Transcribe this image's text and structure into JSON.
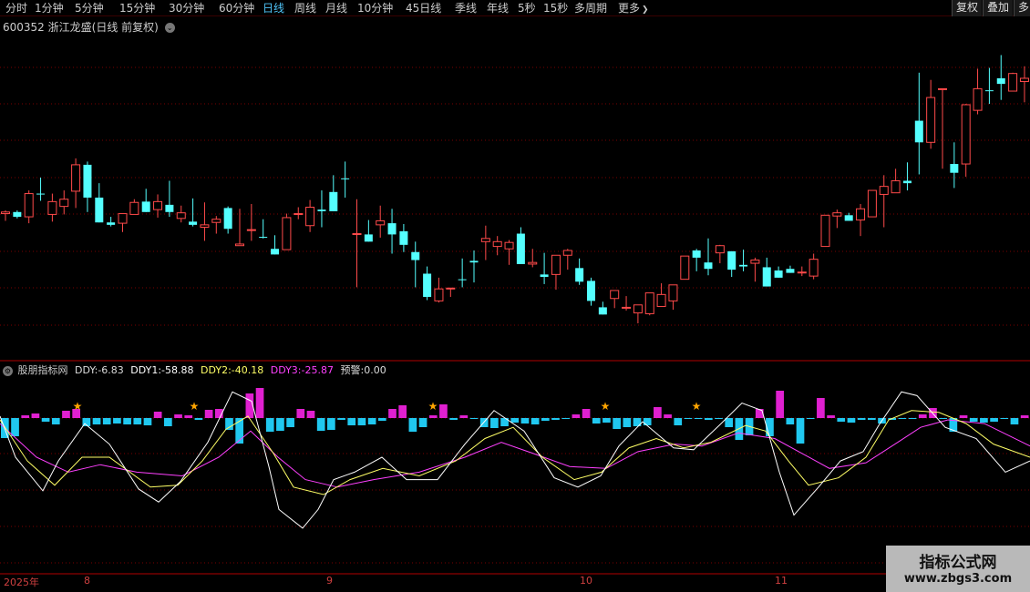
{
  "toolbar": {
    "periods": [
      {
        "label": "分时",
        "active": false
      },
      {
        "label": "1分钟",
        "active": false
      },
      {
        "label": "5分钟",
        "active": false
      },
      {
        "label": "15分钟",
        "active": false
      },
      {
        "label": "30分钟",
        "active": false
      },
      {
        "label": "60分钟",
        "active": false
      },
      {
        "label": "日线",
        "active": true
      },
      {
        "label": "周线",
        "active": false
      },
      {
        "label": "月线",
        "active": false
      },
      {
        "label": "10分钟",
        "active": false
      },
      {
        "label": "45日线",
        "active": false
      },
      {
        "label": "季线",
        "active": false
      },
      {
        "label": "年线",
        "active": false
      },
      {
        "label": "5秒",
        "active": false
      },
      {
        "label": "15秒",
        "active": false
      },
      {
        "label": "多周期",
        "active": false
      },
      {
        "label": "更多",
        "active": false
      }
    ],
    "more_arrow": "❯",
    "right_buttons": [
      "复权",
      "叠加",
      "多"
    ]
  },
  "kline": {
    "code": "600352",
    "name": "浙江龙盛",
    "mode": "(日线 前复权)",
    "dropdown": "⌄"
  },
  "indicator": {
    "name": "股朋指标网",
    "ddy_label": "DDY:",
    "ddy": "-6.83",
    "ddy1_label": "DDY1:",
    "ddy1": "-58.88",
    "ddy2_label": "DDY2:",
    "ddy2": "-40.18",
    "ddy3_label": "DDY3:",
    "ddy3": "-25.87",
    "alert_label": "预警:",
    "alert": "0.00"
  },
  "dates": {
    "year": "2025年",
    "m8": "8",
    "m9": "9",
    "m10": "10",
    "m11": "11"
  },
  "watermark": {
    "title": "指标公式网",
    "url": "www.zbgs3.com"
  },
  "colors": {
    "up": "#ff4a4a",
    "down": "#54ffff",
    "grid": "#7a0000",
    "ddy1": "#ffffff",
    "ddy2": "#ffff66",
    "ddy3": "#ff40ff",
    "bar_pos": "#e020d0",
    "bar_neg": "#20c8f0",
    "star": "#ffa500"
  },
  "kline_data": [
    [
      7.17,
      7.21,
      7.08,
      7.19
    ],
    [
      7.19,
      7.21,
      7.11,
      7.13
    ],
    [
      7.13,
      7.46,
      7.05,
      7.42
    ],
    [
      7.42,
      7.62,
      7.33,
      7.41
    ],
    [
      7.16,
      7.42,
      7.07,
      7.32
    ],
    [
      7.26,
      7.46,
      7.16,
      7.35
    ],
    [
      7.45,
      7.86,
      7.24,
      7.78
    ],
    [
      7.78,
      7.82,
      7.19,
      7.37
    ],
    [
      7.37,
      7.55,
      7.06,
      7.06
    ],
    [
      7.06,
      7.13,
      7.01,
      7.03
    ],
    [
      7.05,
      7.16,
      6.94,
      7.17
    ],
    [
      7.16,
      7.35,
      7.17,
      7.31
    ],
    [
      7.32,
      7.48,
      7.23,
      7.19
    ],
    [
      7.22,
      7.41,
      7.12,
      7.32
    ],
    [
      7.28,
      7.58,
      7.13,
      7.19
    ],
    [
      7.11,
      7.27,
      7.06,
      7.18
    ],
    [
      7.07,
      7.36,
      7.01,
      7.03
    ],
    [
      7.0,
      7.31,
      6.83,
      7.03
    ],
    [
      7.06,
      7.14,
      6.92,
      7.1
    ],
    [
      7.24,
      7.26,
      6.92,
      6.98
    ],
    [
      6.77,
      7.23,
      6.79,
      6.79
    ],
    [
      6.97,
      7.29,
      6.83,
      6.97
    ],
    [
      6.88,
      7.1,
      6.86,
      6.87
    ],
    [
      6.73,
      6.9,
      6.73,
      6.66
    ],
    [
      6.72,
      7.17,
      6.72,
      7.12
    ],
    [
      7.16,
      7.25,
      7.1,
      7.17
    ],
    [
      7.02,
      7.34,
      6.94,
      7.25
    ],
    [
      7.22,
      7.46,
      7.0,
      7.2
    ],
    [
      7.44,
      7.65,
      7.32,
      7.2
    ],
    [
      7.61,
      7.82,
      7.37,
      7.6
    ],
    [
      6.92,
      7.35,
      6.25,
      6.92
    ],
    [
      6.91,
      7.09,
      6.82,
      6.82
    ],
    [
      7.03,
      7.27,
      6.87,
      7.08
    ],
    [
      7.05,
      7.23,
      6.67,
      6.91
    ],
    [
      6.95,
      7.04,
      6.69,
      6.78
    ],
    [
      6.69,
      6.82,
      6.25,
      6.59
    ],
    [
      6.42,
      6.51,
      6.09,
      6.13
    ],
    [
      6.08,
      6.37,
      6.06,
      6.23
    ],
    [
      6.23,
      6.17,
      6.13,
      6.24
    ],
    [
      6.35,
      6.61,
      6.25,
      6.34
    ],
    [
      6.58,
      6.71,
      6.31,
      6.56
    ],
    [
      6.82,
      7.02,
      6.59,
      6.86
    ],
    [
      6.76,
      6.89,
      6.65,
      6.82
    ],
    [
      6.73,
      6.84,
      6.53,
      6.81
    ],
    [
      6.92,
      7.0,
      6.65,
      6.54
    ],
    [
      6.54,
      6.73,
      6.5,
      6.56
    ],
    [
      6.41,
      6.68,
      6.29,
      6.38
    ],
    [
      6.41,
      6.56,
      6.22,
      6.65
    ],
    [
      6.65,
      6.73,
      6.47,
      6.71
    ],
    [
      6.49,
      6.61,
      6.28,
      6.32
    ],
    [
      6.33,
      6.37,
      6.02,
      6.08
    ],
    [
      6.0,
      6.07,
      5.91,
      5.91
    ],
    [
      6.11,
      6.12,
      5.99,
      6.21
    ],
    [
      6.0,
      6.14,
      5.96,
      6.0
    ],
    [
      5.93,
      5.99,
      5.8,
      6.03
    ],
    [
      5.92,
      6.16,
      5.9,
      6.18
    ],
    [
      6.01,
      6.3,
      6.08,
      6.16
    ],
    [
      6.08,
      6.23,
      5.97,
      6.28
    ],
    [
      6.35,
      6.58,
      6.49,
      6.64
    ],
    [
      6.71,
      6.73,
      6.45,
      6.62
    ],
    [
      6.56,
      6.86,
      6.4,
      6.48
    ],
    [
      6.68,
      6.78,
      6.55,
      6.77
    ],
    [
      6.7,
      6.62,
      6.38,
      6.47
    ],
    [
      6.53,
      6.72,
      6.45,
      6.51
    ],
    [
      6.55,
      6.62,
      6.32,
      6.59
    ],
    [
      6.5,
      6.62,
      6.29,
      6.26
    ],
    [
      6.46,
      6.51,
      6.4,
      6.37
    ],
    [
      6.48,
      6.52,
      6.45,
      6.43
    ],
    [
      6.44,
      6.51,
      6.39,
      6.44
    ],
    [
      6.39,
      6.67,
      6.35,
      6.6
    ],
    [
      6.76,
      7.12,
      6.76,
      7.15
    ],
    [
      7.14,
      7.22,
      6.99,
      7.18
    ],
    [
      7.15,
      7.18,
      7.15,
      7.08
    ],
    [
      7.09,
      7.29,
      6.89,
      7.23
    ],
    [
      7.13,
      7.39,
      7.13,
      7.46
    ],
    [
      7.41,
      7.65,
      7.0,
      7.51
    ],
    [
      7.43,
      7.73,
      7.43,
      7.58
    ],
    [
      7.58,
      7.81,
      7.46,
      7.55
    ],
    [
      8.33,
      8.93,
      7.66,
      8.06
    ],
    [
      8.06,
      8.84,
      7.98,
      8.62
    ],
    [
      8.73,
      8.73,
      7.73,
      8.73
    ],
    [
      7.79,
      8.06,
      7.49,
      7.68
    ],
    [
      7.79,
      8.54,
      7.63,
      8.53
    ],
    [
      8.46,
      8.98,
      8.41,
      8.73
    ],
    [
      8.71,
      8.99,
      8.54,
      8.7
    ],
    [
      8.86,
      9.15,
      8.59,
      8.79
    ],
    [
      8.7,
      8.93,
      8.83,
      8.92
    ],
    [
      8.82,
      9.01,
      8.56,
      8.86
    ],
    [
      8.77,
      9.09,
      8.79,
      8.81
    ],
    [
      8.73,
      9.0,
      8.57,
      8.95
    ],
    [
      9.01,
      9.36,
      8.69,
      9.17
    ],
    [
      8.94,
      9.32,
      8.75,
      8.75
    ],
    [
      8.97,
      9.14,
      8.74,
      8.99
    ],
    [
      8.99,
      9.09,
      8.7,
      8.91
    ],
    [
      8.82,
      9.0,
      8.73,
      8.7
    ],
    [
      8.69,
      8.62,
      8.55,
      8.48
    ],
    [
      8.31,
      8.46,
      8.02,
      8.07
    ],
    [
      7.72,
      7.85,
      7.47,
      7.52
    ],
    [
      7.55,
      7.6,
      7.18,
      7.29
    ],
    [
      7.31,
      7.36,
      7.2,
      7.24
    ],
    [
      7.25,
      7.31,
      7.13,
      7.19
    ],
    [
      7.16,
      7.32,
      7.13,
      7.32
    ],
    [
      7.26,
      7.39,
      7.19,
      7.34
    ],
    [
      7.39,
      7.44,
      7.25,
      7.44
    ],
    [
      7.4,
      7.59,
      7.36,
      7.53
    ],
    [
      7.47,
      7.61,
      7.46,
      7.48
    ],
    [
      7.58,
      7.81,
      7.46,
      7.74
    ]
  ],
  "bars": [
    -22,
    -20,
    3,
    5,
    -4,
    -7,
    8,
    10,
    -9,
    -7,
    -7,
    -6,
    -7,
    -7,
    -8,
    7,
    -9,
    4,
    3,
    -2,
    9,
    10,
    -13,
    -28,
    27,
    33,
    -15,
    -14,
    -10,
    10,
    8,
    -14,
    -13,
    -2,
    -8,
    -8,
    -7,
    -3,
    10,
    14,
    -15,
    -10,
    3,
    15,
    -2,
    3,
    -1,
    -10,
    -11,
    -9,
    -5,
    -6,
    -7,
    -3,
    -2,
    -1,
    4,
    10,
    -6,
    -5,
    -12,
    -10,
    -9,
    -8,
    12,
    4,
    -8,
    -1,
    -1,
    -2,
    -1,
    -10,
    -24,
    -19,
    10,
    -20,
    30,
    -7,
    -28,
    -1,
    22,
    3,
    -4,
    -5,
    -2,
    -2,
    -6,
    -2,
    -1,
    -1,
    4,
    11,
    -1,
    -15,
    3,
    -4,
    -5,
    -4,
    -1,
    -7,
    3
  ],
  "stars": [
    85,
    213,
    475,
    664,
    764
  ],
  "lines": {
    "ddy1": [
      [
        0,
        0.18
      ],
      [
        17,
        0.4
      ],
      [
        47,
        0.58
      ],
      [
        64,
        0.42
      ],
      [
        93,
        0.22
      ],
      [
        120,
        0.33
      ],
      [
        152,
        0.57
      ],
      [
        174,
        0.64
      ],
      [
        198,
        0.53
      ],
      [
        228,
        0.32
      ],
      [
        255,
        0.05
      ],
      [
        276,
        0.1
      ],
      [
        295,
        0.45
      ],
      [
        306,
        0.68
      ],
      [
        332,
        0.78
      ],
      [
        349,
        0.68
      ],
      [
        366,
        0.52
      ],
      [
        389,
        0.48
      ],
      [
        419,
        0.4
      ],
      [
        446,
        0.52
      ],
      [
        480,
        0.52
      ],
      [
        510,
        0.33
      ],
      [
        542,
        0.15
      ],
      [
        575,
        0.26
      ],
      [
        608,
        0.51
      ],
      [
        634,
        0.56
      ],
      [
        659,
        0.5
      ],
      [
        679,
        0.34
      ],
      [
        705,
        0.21
      ],
      [
        739,
        0.35
      ],
      [
        761,
        0.36
      ],
      [
        789,
        0.23
      ],
      [
        814,
        0.11
      ],
      [
        836,
        0.15
      ],
      [
        855,
        0.48
      ],
      [
        871,
        0.71
      ],
      [
        898,
        0.56
      ],
      [
        922,
        0.42
      ],
      [
        947,
        0.37
      ],
      [
        964,
        0.23
      ],
      [
        989,
        0.05
      ],
      [
        1006,
        0.07
      ],
      [
        1037,
        0.24
      ],
      [
        1071,
        0.3
      ],
      [
        1103,
        0.48
      ],
      [
        1130,
        0.42
      ]
    ],
    "ddy2": [
      [
        0,
        0.2
      ],
      [
        30,
        0.42
      ],
      [
        60,
        0.55
      ],
      [
        90,
        0.4
      ],
      [
        120,
        0.4
      ],
      [
        165,
        0.56
      ],
      [
        195,
        0.55
      ],
      [
        222,
        0.42
      ],
      [
        248,
        0.25
      ],
      [
        272,
        0.18
      ],
      [
        300,
        0.38
      ],
      [
        322,
        0.56
      ],
      [
        355,
        0.6
      ],
      [
        384,
        0.52
      ],
      [
        420,
        0.46
      ],
      [
        460,
        0.5
      ],
      [
        500,
        0.42
      ],
      [
        532,
        0.3
      ],
      [
        563,
        0.24
      ],
      [
        595,
        0.4
      ],
      [
        630,
        0.52
      ],
      [
        660,
        0.48
      ],
      [
        690,
        0.35
      ],
      [
        720,
        0.3
      ],
      [
        750,
        0.35
      ],
      [
        780,
        0.32
      ],
      [
        818,
        0.23
      ],
      [
        840,
        0.26
      ],
      [
        865,
        0.42
      ],
      [
        887,
        0.55
      ],
      [
        920,
        0.51
      ],
      [
        950,
        0.4
      ],
      [
        975,
        0.2
      ],
      [
        1000,
        0.15
      ],
      [
        1030,
        0.16
      ],
      [
        1060,
        0.22
      ],
      [
        1090,
        0.33
      ],
      [
        1130,
        0.4
      ]
    ],
    "ddy3": [
      [
        0,
        0.22
      ],
      [
        40,
        0.4
      ],
      [
        75,
        0.48
      ],
      [
        110,
        0.44
      ],
      [
        150,
        0.48
      ],
      [
        200,
        0.5
      ],
      [
        240,
        0.4
      ],
      [
        275,
        0.26
      ],
      [
        305,
        0.4
      ],
      [
        335,
        0.52
      ],
      [
        370,
        0.56
      ],
      [
        410,
        0.52
      ],
      [
        460,
        0.48
      ],
      [
        510,
        0.4
      ],
      [
        550,
        0.32
      ],
      [
        585,
        0.38
      ],
      [
        625,
        0.45
      ],
      [
        665,
        0.46
      ],
      [
        700,
        0.37
      ],
      [
        740,
        0.33
      ],
      [
        770,
        0.34
      ],
      [
        810,
        0.27
      ],
      [
        850,
        0.3
      ],
      [
        880,
        0.38
      ],
      [
        910,
        0.46
      ],
      [
        950,
        0.43
      ],
      [
        985,
        0.32
      ],
      [
        1010,
        0.24
      ],
      [
        1040,
        0.2
      ],
      [
        1080,
        0.22
      ],
      [
        1130,
        0.34
      ]
    ]
  }
}
